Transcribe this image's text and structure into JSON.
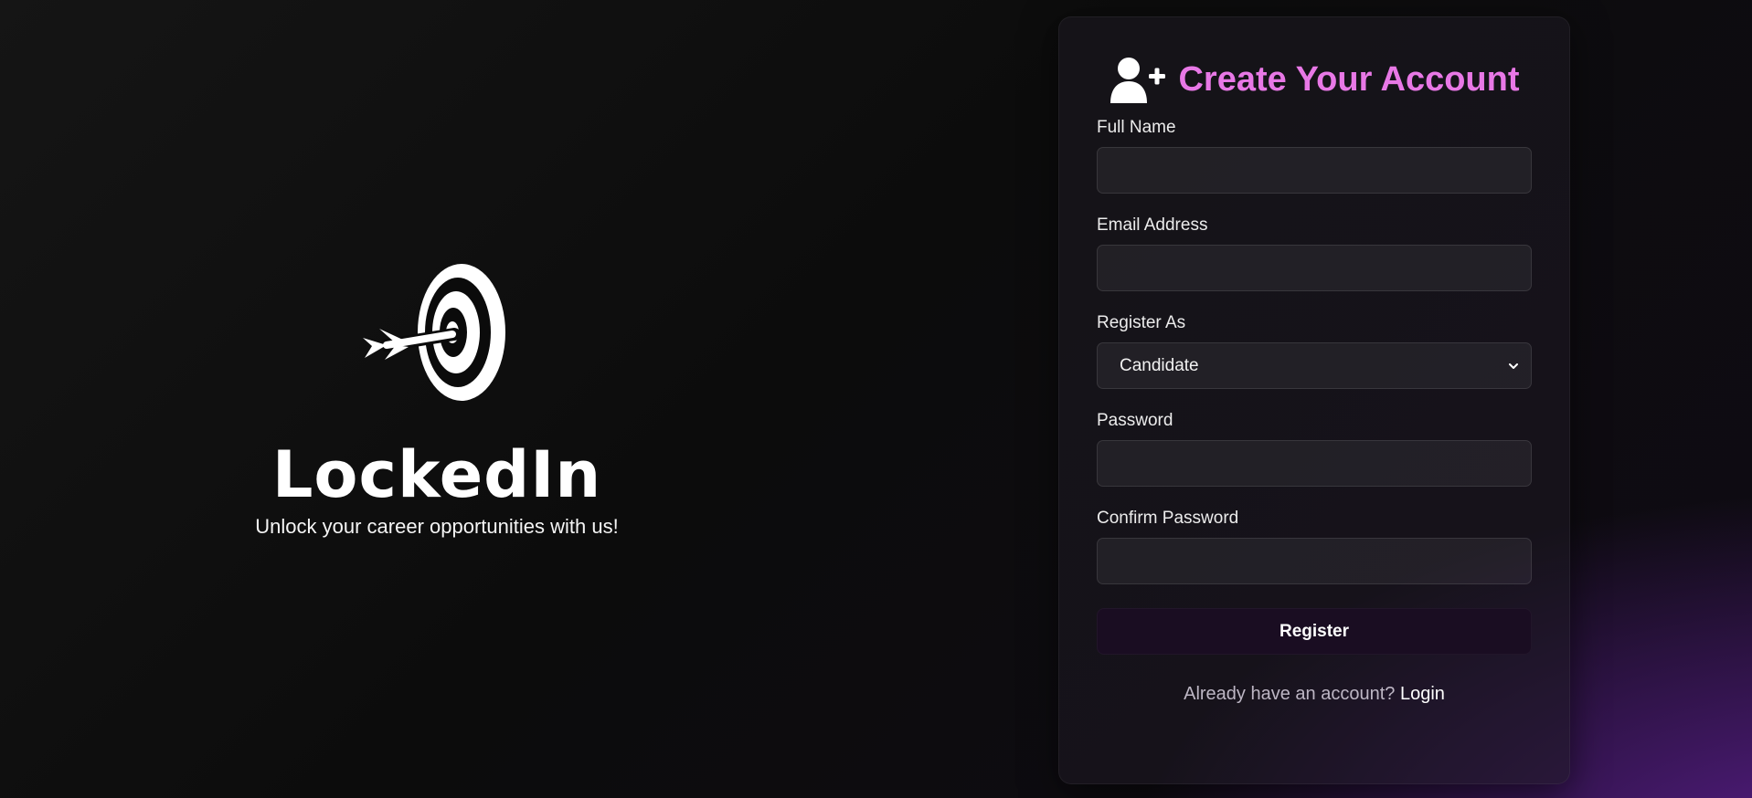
{
  "brand": {
    "name": "LockedIn",
    "tagline": "Unlock your career opportunities with us!",
    "logo_icon": "target-arrow-icon"
  },
  "form": {
    "title": "Create Your Account",
    "title_icon": "user-plus-icon",
    "fields": {
      "full_name": {
        "label": "Full Name",
        "value": ""
      },
      "email": {
        "label": "Email Address",
        "value": ""
      },
      "register_as": {
        "label": "Register As",
        "selected": "Candidate"
      },
      "password": {
        "label": "Password",
        "value": ""
      },
      "confirm_password": {
        "label": "Confirm Password",
        "value": ""
      }
    },
    "submit_label": "Register",
    "login_prompt": "Already have an account?",
    "login_link": "Login"
  },
  "colors": {
    "accent": "#e878e6",
    "background_glow": "#5a1e8c",
    "button_bg": "#1a0d22"
  }
}
